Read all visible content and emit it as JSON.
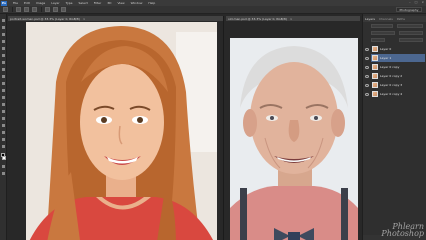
{
  "app": {
    "logo_text": "Ps"
  },
  "menubar": {
    "items": [
      "File",
      "Edit",
      "Image",
      "Layer",
      "Type",
      "Select",
      "Filter",
      "3D",
      "View",
      "Window",
      "Help"
    ]
  },
  "optionsbar": {
    "workspace": "Photography"
  },
  "documents": [
    {
      "tab_title": "portrait-woman.psd @ 33.3% (Layer 0, RGB/8)",
      "close": "×"
    },
    {
      "tab_title": "old-man.psd @ 33.3% (Layer 0, RGB/8)",
      "close": "×"
    }
  ],
  "layers_panel": {
    "tabs": [
      "Layers",
      "Channels",
      "Paths"
    ],
    "layers": [
      {
        "name": "Layer 0",
        "selected": false
      },
      {
        "name": "Layer 1",
        "selected": true
      },
      {
        "name": "Layer 0 copy",
        "selected": false
      },
      {
        "name": "Layer 0 copy 2",
        "selected": false
      },
      {
        "name": "Layer 0 copy 3",
        "selected": false
      },
      {
        "name": "Layer 0 copy 4",
        "selected": false
      }
    ]
  },
  "watermark": {
    "line1": "Phlearn",
    "line2": "Photoshop"
  },
  "colors": {
    "ui_dark": "#282828",
    "selection": "#4c6790",
    "ps_blue": "#2a6cc0"
  }
}
